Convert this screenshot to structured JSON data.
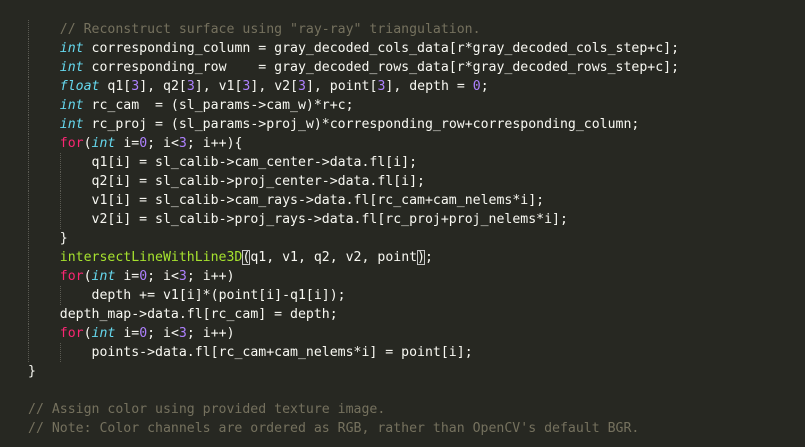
{
  "editor": {
    "theme": "Monokai",
    "colors": {
      "background": "#272822",
      "plain": "#f8f8f2",
      "keyword": "#f92672",
      "type": "#66d9ef",
      "number": "#ae81ff",
      "comment": "#75715e",
      "function": "#a6e22e"
    },
    "lines": [
      {
        "indent": 1,
        "segments": [
          {
            "c": "c",
            "t": "// Reconstruct surface using \"ray-ray\" triangulation."
          }
        ]
      },
      {
        "indent": 1,
        "segments": [
          {
            "c": "t",
            "t": "int"
          },
          {
            "c": "p",
            "t": " corresponding_column = gray_decoded_cols_data[r*gray_decoded_cols_step+c];"
          }
        ]
      },
      {
        "indent": 1,
        "segments": [
          {
            "c": "t",
            "t": "int"
          },
          {
            "c": "p",
            "t": " corresponding_row    = gray_decoded_rows_data[r*gray_decoded_rows_step+c];"
          }
        ]
      },
      {
        "indent": 1,
        "segments": [
          {
            "c": "t",
            "t": "float"
          },
          {
            "c": "p",
            "t": " q1["
          },
          {
            "c": "n",
            "t": "3"
          },
          {
            "c": "p",
            "t": "], q2["
          },
          {
            "c": "n",
            "t": "3"
          },
          {
            "c": "p",
            "t": "], v1["
          },
          {
            "c": "n",
            "t": "3"
          },
          {
            "c": "p",
            "t": "], v2["
          },
          {
            "c": "n",
            "t": "3"
          },
          {
            "c": "p",
            "t": "], point["
          },
          {
            "c": "n",
            "t": "3"
          },
          {
            "c": "p",
            "t": "], depth = "
          },
          {
            "c": "n",
            "t": "0"
          },
          {
            "c": "p",
            "t": ";"
          }
        ]
      },
      {
        "indent": 1,
        "segments": [
          {
            "c": "t",
            "t": "int"
          },
          {
            "c": "p",
            "t": " rc_cam  = (sl_params->cam_w)*r+c;"
          }
        ]
      },
      {
        "indent": 1,
        "segments": [
          {
            "c": "t",
            "t": "int"
          },
          {
            "c": "p",
            "t": " rc_proj = (sl_params->proj_w)*corresponding_row+corresponding_column;"
          }
        ]
      },
      {
        "indent": 1,
        "segments": [
          {
            "c": "k",
            "t": "for"
          },
          {
            "c": "p",
            "t": "("
          },
          {
            "c": "t",
            "t": "int"
          },
          {
            "c": "p",
            "t": " i="
          },
          {
            "c": "n",
            "t": "0"
          },
          {
            "c": "p",
            "t": "; i<"
          },
          {
            "c": "n",
            "t": "3"
          },
          {
            "c": "p",
            "t": "; i++){"
          }
        ]
      },
      {
        "indent": 2,
        "segments": [
          {
            "c": "p",
            "t": "q1[i] = sl_calib->cam_center->data.fl[i];"
          }
        ]
      },
      {
        "indent": 2,
        "segments": [
          {
            "c": "p",
            "t": "q2[i] = sl_calib->proj_center->data.fl[i];"
          }
        ]
      },
      {
        "indent": 2,
        "segments": [
          {
            "c": "p",
            "t": "v1[i] = sl_calib->cam_rays->data.fl[rc_cam+cam_nelems*i];"
          }
        ]
      },
      {
        "indent": 2,
        "segments": [
          {
            "c": "p",
            "t": "v2[i] = sl_calib->proj_rays->data.fl[rc_proj+proj_nelems*i];"
          }
        ]
      },
      {
        "indent": 1,
        "segments": [
          {
            "c": "p",
            "t": "}"
          }
        ]
      },
      {
        "indent": 1,
        "segments": [
          {
            "c": "f",
            "t": "intersectLineWithLine3D"
          },
          {
            "c": "p",
            "t": "(",
            "bracket": true
          },
          {
            "c": "p",
            "t": "q1, v1, q2, v2, point"
          },
          {
            "c": "p",
            "t": ")",
            "bracket": true
          },
          {
            "c": "p",
            "t": ";"
          }
        ]
      },
      {
        "indent": 1,
        "segments": [
          {
            "c": "k",
            "t": "for"
          },
          {
            "c": "p",
            "t": "("
          },
          {
            "c": "t",
            "t": "int"
          },
          {
            "c": "p",
            "t": " i="
          },
          {
            "c": "n",
            "t": "0"
          },
          {
            "c": "p",
            "t": "; i<"
          },
          {
            "c": "n",
            "t": "3"
          },
          {
            "c": "p",
            "t": "; i++)"
          }
        ]
      },
      {
        "indent": 2,
        "segments": [
          {
            "c": "p",
            "t": "depth += v1[i]*(point[i]-q1[i]);"
          }
        ]
      },
      {
        "indent": 1,
        "segments": [
          {
            "c": "p",
            "t": "depth_map->data.fl[rc_cam] = depth;"
          }
        ]
      },
      {
        "indent": 1,
        "segments": [
          {
            "c": "k",
            "t": "for"
          },
          {
            "c": "p",
            "t": "("
          },
          {
            "c": "t",
            "t": "int"
          },
          {
            "c": "p",
            "t": " i="
          },
          {
            "c": "n",
            "t": "0"
          },
          {
            "c": "p",
            "t": "; i<"
          },
          {
            "c": "n",
            "t": "3"
          },
          {
            "c": "p",
            "t": "; i++)"
          }
        ]
      },
      {
        "indent": 2,
        "segments": [
          {
            "c": "p",
            "t": "points->data.fl[rc_cam+cam_nelems*i] = point[i];"
          }
        ]
      },
      {
        "indent": 0,
        "segments": [
          {
            "c": "p",
            "t": "}"
          }
        ]
      },
      {
        "indent": 0,
        "segments": []
      },
      {
        "indent": 0,
        "segments": [
          {
            "c": "c",
            "t": "// Assign color using provided texture image."
          }
        ]
      },
      {
        "indent": 0,
        "segments": [
          {
            "c": "c",
            "t": "// Note: Color channels are ordered as RGB, rather than OpenCV's default BGR."
          }
        ]
      }
    ]
  }
}
